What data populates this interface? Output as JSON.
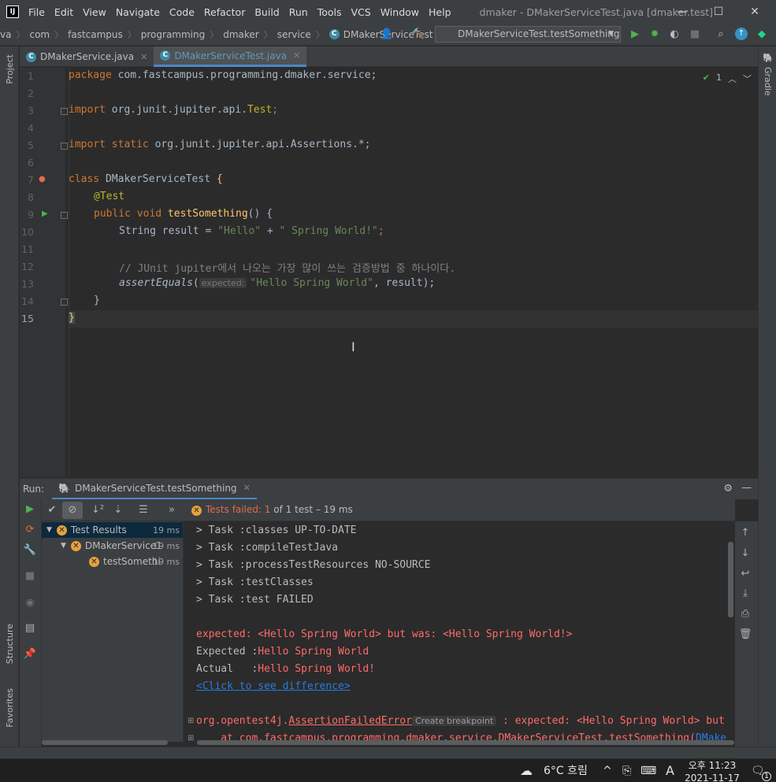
{
  "app": {
    "logo": "IJ",
    "window_title": "dmaker - DMakerServiceTest.java [dmaker.test]",
    "menu": [
      "File",
      "Edit",
      "View",
      "Navigate",
      "Code",
      "Refactor",
      "Build",
      "Run",
      "Tools",
      "VCS",
      "Window",
      "Help"
    ]
  },
  "breadcrumbs": [
    "va",
    "com",
    "fastcampus",
    "programming",
    "dmaker",
    "service",
    "DMakerServiceTest"
  ],
  "run_config": "DMakerServiceTest.testSomething",
  "side_tabs": {
    "project": "Project",
    "structure": "Structure",
    "favorites": "Favorites",
    "gradle": "Gradle"
  },
  "editor_tabs": [
    {
      "label": "DMakerService.java",
      "active": false
    },
    {
      "label": "DMakerServiceTest.java",
      "active": true
    }
  ],
  "inspection": {
    "count": "1"
  },
  "code": {
    "lines": [
      "1",
      "2",
      "3",
      "4",
      "5",
      "6",
      "7",
      "8",
      "9",
      "10",
      "11",
      "12",
      "13",
      "14",
      "15"
    ],
    "l1_kw": "package",
    "l1_rest": " com.fastcampus.programming.dmaker.service;",
    "l3_kw": "import",
    "l3_rest": " org.junit.jupiter.api.",
    "l3_cls": "Test",
    "l3_end": ";",
    "l5_kw": "import static",
    "l5_rest": " org.junit.jupiter.api.Assertions.*;",
    "l7_kw": "class",
    "l7_name": " DMakerServiceTest ",
    "l7_brace": "{",
    "l8_ann": "@Test",
    "l9_kw": "public void",
    "l9_fn": " testSomething",
    "l9_rest": "() {",
    "l10_type": "String result = ",
    "l10_s1": "\"Hello\"",
    "l10_plus": " + ",
    "l10_s2": "\" Spring World!\"",
    "l10_end": ";",
    "l12_cmt": "// JUnit jupiter에서 나오는 가장 많이 쓰는 검증방법 중 하나이다.",
    "l13_fn": "assertEquals",
    "l13_open": "(",
    "l13_hint": "expected:",
    "l13_str": "\"Hello Spring World\"",
    "l13_rest": ", result);",
    "l14": "}",
    "l15": "}"
  },
  "run_panel": {
    "title": "Run:",
    "tab": "DMakerServiceTest.testSomething",
    "status_fail": "Tests failed: 1",
    "status_rest": " of 1 test – 19 ms",
    "tree": [
      {
        "label": "Test Results",
        "time": "19 ms"
      },
      {
        "label": "DMakerService1",
        "time": "19 ms"
      },
      {
        "label": "testSomethi",
        "time": "19 ms"
      }
    ],
    "console": {
      "c1": "> Task :classes UP-TO-DATE",
      "c2": "> Task :compileTestJava",
      "c3": "> Task :processTestResources NO-SOURCE",
      "c4": "> Task :testClasses",
      "c5": "> Task :test FAILED",
      "c7": "expected: <Hello Spring World> but was: <Hello Spring World!>",
      "c8_label": "Expected :",
      "c8_val": "Hello Spring World",
      "c9_label": "Actual   :",
      "c9_val": "Hello Spring World!",
      "c10": "<Click to see difference>",
      "c12_pre": "org.opentest4j.",
      "c12_cls": "AssertionFailedError",
      "c12_badge": "Create breakpoint",
      "c12_rest": " : expected: <Hello Spring World> but",
      "c13": "    at com.fastcampus.programming.dmaker.service.DMakerServiceTest.testSomething(",
      "c13_link": "DMake"
    }
  },
  "taskbar": {
    "weather": "6°C 흐림",
    "ime": "A",
    "time": "오후 11:23",
    "date": "2021-11-17",
    "notif": "1"
  }
}
